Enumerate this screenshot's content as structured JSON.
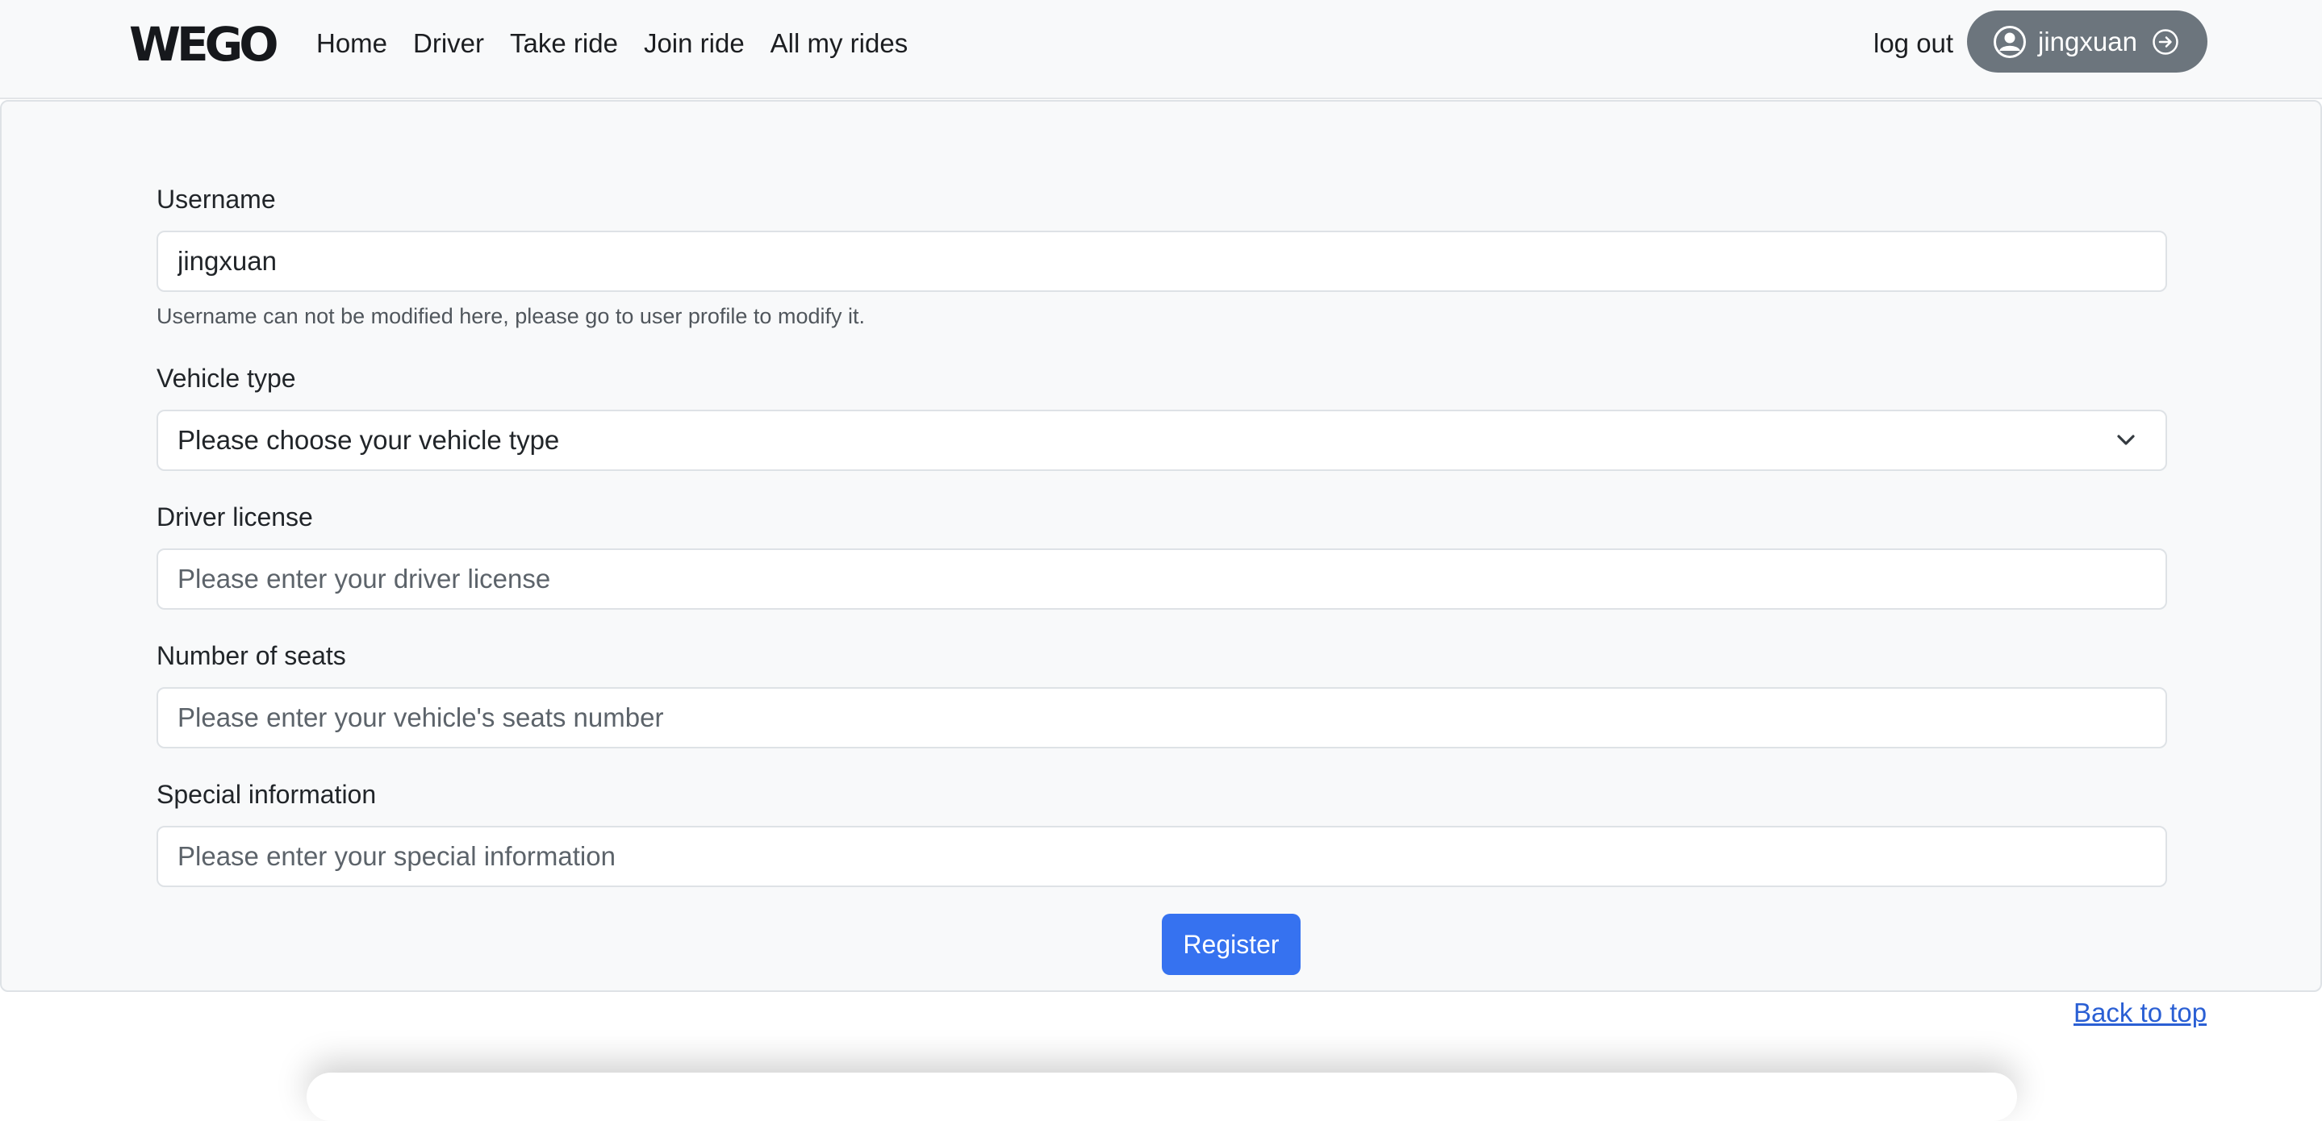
{
  "brand": {
    "logo_text": "WEGO"
  },
  "nav": {
    "links": [
      {
        "label": "Home"
      },
      {
        "label": "Driver"
      },
      {
        "label": "Take ride"
      },
      {
        "label": "Join ride"
      },
      {
        "label": "All my rides"
      }
    ],
    "logout_label": "log out",
    "user": {
      "name": "jingxuan",
      "icon": "person-circle-icon",
      "action_icon": "arrow-right-circle-icon"
    }
  },
  "form": {
    "username": {
      "label": "Username",
      "value": "jingxuan",
      "help": "Username can not be modified here, please go to user profile to modify it."
    },
    "vehicle_type": {
      "label": "Vehicle type",
      "selected": "Please choose your vehicle type"
    },
    "driver_license": {
      "label": "Driver license",
      "placeholder": "Please enter your driver license"
    },
    "seats": {
      "label": "Number of seats",
      "placeholder": "Please enter your vehicle's seats number"
    },
    "special_info": {
      "label": "Special information",
      "placeholder": "Please enter your special information"
    },
    "submit_label": "Register"
  },
  "footer": {
    "back_to_top": "Back to top"
  },
  "colors": {
    "primary": "#3672f0",
    "user_pill": "#6c757d",
    "link": "#2a5fd4",
    "panel_bg": "#f8f9fa"
  }
}
